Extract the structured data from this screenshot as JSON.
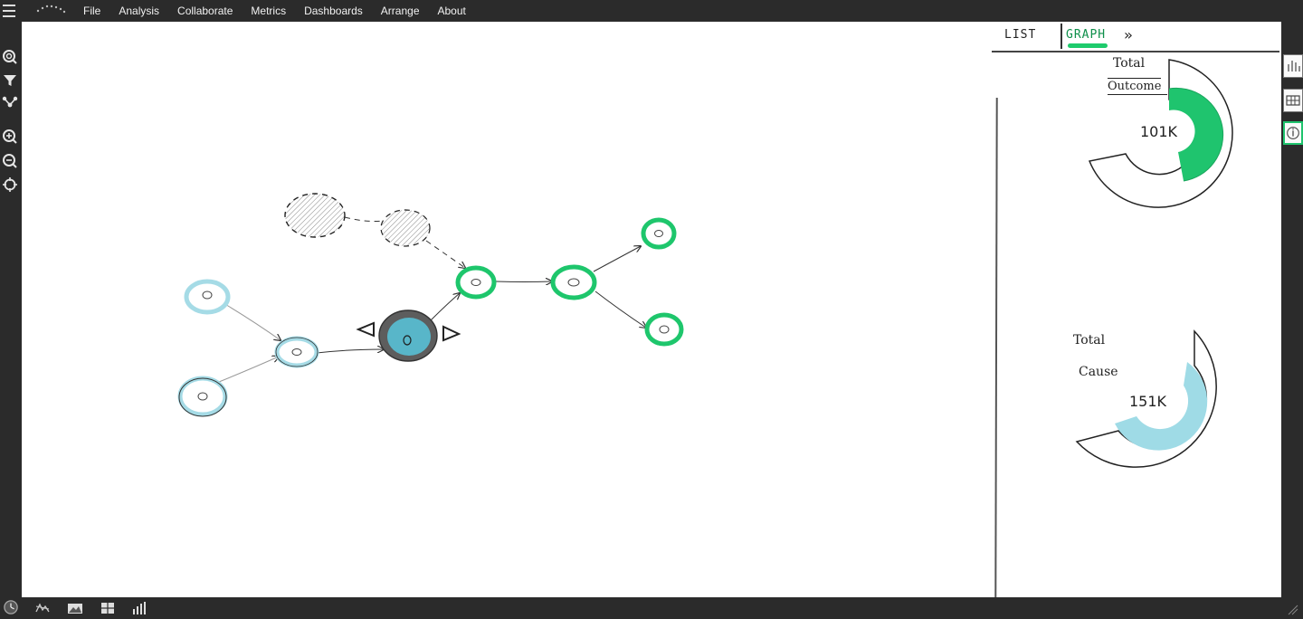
{
  "menu": {
    "items": [
      "File",
      "Analysis",
      "Collaborate",
      "Metrics",
      "Dashboards",
      "Arrange",
      "About"
    ]
  },
  "icons": {
    "hamburger": "menu-icon",
    "logo": "app-logo",
    "left_tools": [
      "search-node-icon",
      "filter-icon",
      "share-graph-icon",
      "zoom-in-icon",
      "zoom-out-icon",
      "recenter-icon"
    ],
    "right_strip": [
      "bar-chart-icon",
      "chart-grid-icon",
      "info-icon"
    ],
    "bottom": [
      "timeline-icon",
      "map-icon",
      "image-icon",
      "grid-icon",
      "histogram-icon"
    ]
  },
  "panel": {
    "tabs": {
      "list": "LIST",
      "graph": "GRAPH",
      "more": "»"
    },
    "active_tab": "graph",
    "donuts": [
      {
        "label_line1": "Total",
        "label_line2": "Outcome",
        "value": "101K",
        "color": "#1fc46e",
        "fill_fraction": 0.38
      },
      {
        "label_line1": "Total",
        "label_line2": "Cause",
        "value": "151K",
        "color": "#9fdbe6",
        "fill_fraction": 0.72
      }
    ]
  },
  "colors": {
    "frame": "#2b2b2b",
    "accent_green": "#1fc46e",
    "accent_cyan": "#9fdbe6",
    "selected_node": "#4fb3c8"
  }
}
